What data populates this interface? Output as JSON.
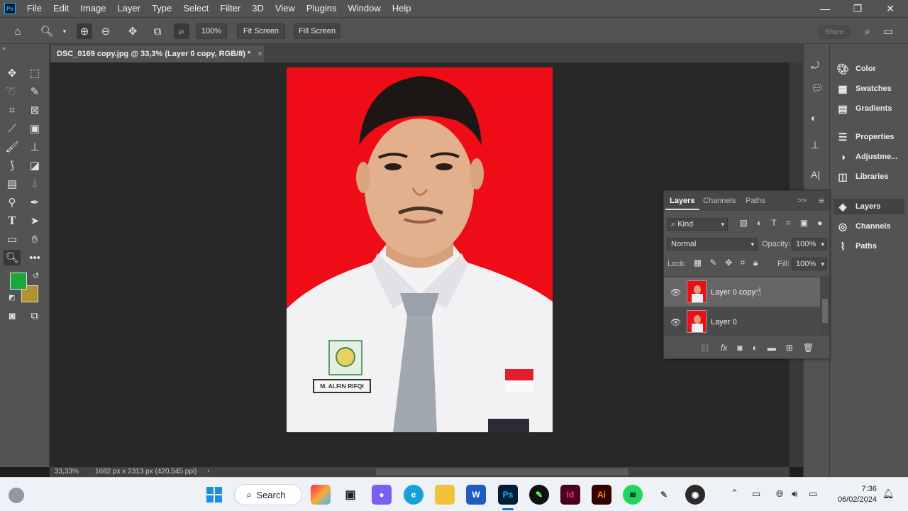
{
  "menubar": {
    "logo": "Ps",
    "items": [
      "File",
      "Edit",
      "Image",
      "Layer",
      "Type",
      "Select",
      "Filter",
      "3D",
      "View",
      "Plugins",
      "Window",
      "Help"
    ],
    "window_controls": [
      "—",
      "❐",
      "✕"
    ]
  },
  "options": {
    "zoom_value": "100%",
    "fit_screen": "Fit Screen",
    "fill_screen": "Fill Screen",
    "share": "Share"
  },
  "document": {
    "tab_title": "DSC_0169 copy.jpg @ 33,3% (Layer 0 copy, RGB/8) *",
    "tab_close": "×",
    "name_tag": "M. ALFIN RIFQI"
  },
  "status": {
    "zoom": "33,33%",
    "info": "1682 px x 2313 px (420,545 ppi)",
    "arrow": "›"
  },
  "colors": {
    "foreground": "#1aa83a",
    "background": "#b4912e",
    "photo_bg": "#ee0c16"
  },
  "dock": {
    "items": [
      {
        "icon": "color-icon",
        "label": "Color"
      },
      {
        "icon": "swatches-icon",
        "label": "Swatches"
      },
      {
        "icon": "gradients-icon",
        "label": "Gradients"
      },
      {
        "icon": "properties-icon",
        "label": "Properties"
      },
      {
        "icon": "adjustments-icon",
        "label": "Adjustme..."
      },
      {
        "icon": "libraries-icon",
        "label": "Libraries"
      },
      {
        "icon": "layers-icon",
        "label": "Layers"
      },
      {
        "icon": "channels-icon",
        "label": "Channels"
      },
      {
        "icon": "paths-icon",
        "label": "Paths"
      }
    ]
  },
  "layers_panel": {
    "tabs": [
      "Layers",
      "Channels",
      "Paths"
    ],
    "collapse": ">>",
    "filter_kind": "Kind",
    "blend_mode": "Normal",
    "opacity_label": "Opacity:",
    "opacity_value": "100%",
    "lock_label": "Lock:",
    "fill_label": "Fill:",
    "fill_value": "100%",
    "layers": [
      {
        "name": "Layer 0 copy",
        "visible": true,
        "selected": true
      },
      {
        "name": "Layer 0",
        "visible": true,
        "selected": false
      }
    ]
  },
  "taskbar": {
    "search": "Search",
    "apps": [
      "Copilot",
      "Task View",
      "Teams",
      "Edge",
      "File Explorer",
      "Word",
      "Photoshop",
      "CorelDRAW",
      "InDesign",
      "Illustrator",
      "Spotify",
      "Pen App",
      "OBS"
    ],
    "ps_label": "Ps",
    "id_label": "Id",
    "ai_label": "Ai",
    "word_label": "W",
    "time": "7:36",
    "date": "06/02/2024"
  }
}
